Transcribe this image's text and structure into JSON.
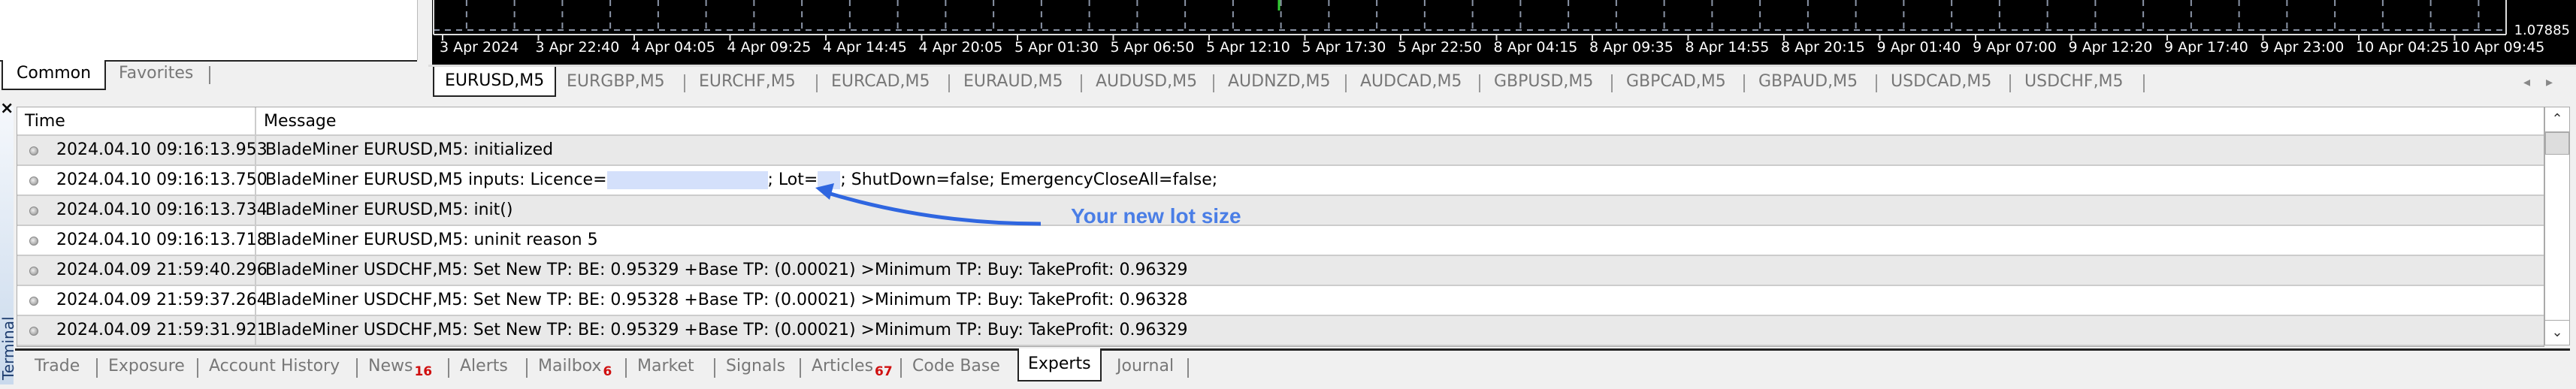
{
  "navigator": {
    "tabs": [
      {
        "label": "Common",
        "active": true
      },
      {
        "label": "Favorites",
        "active": false
      }
    ]
  },
  "chart": {
    "symbol": "EURUSD,M5",
    "price_label": "1.07885",
    "candle_color": "#33cc33",
    "time_labels": [
      "3 Apr 2024",
      "3 Apr 22:40",
      "4 Apr 04:05",
      "4 Apr 09:25",
      "4 Apr 14:45",
      "4 Apr 20:05",
      "5 Apr 01:30",
      "5 Apr 06:50",
      "5 Apr 12:10",
      "5 Apr 17:30",
      "5 Apr 22:50",
      "8 Apr 04:15",
      "8 Apr 09:35",
      "8 Apr 14:55",
      "8 Apr 20:15",
      "9 Apr 01:40",
      "9 Apr 07:00",
      "9 Apr 12:20",
      "9 Apr 17:40",
      "9 Apr 23:00",
      "10 Apr 04:25",
      "10 Apr 09:45"
    ]
  },
  "symbol_tabs": [
    {
      "label": "EURUSD,M5",
      "active": true
    },
    {
      "label": "EURGBP,M5",
      "active": false
    },
    {
      "label": "EURCHF,M5",
      "active": false
    },
    {
      "label": "EURCAD,M5",
      "active": false
    },
    {
      "label": "EURAUD,M5",
      "active": false
    },
    {
      "label": "AUDUSD,M5",
      "active": false
    },
    {
      "label": "AUDNZD,M5",
      "active": false
    },
    {
      "label": "AUDCAD,M5",
      "active": false
    },
    {
      "label": "GBPUSD,M5",
      "active": false
    },
    {
      "label": "GBPCAD,M5",
      "active": false
    },
    {
      "label": "GBPAUD,M5",
      "active": false
    },
    {
      "label": "USDCAD,M5",
      "active": false
    },
    {
      "label": "USDCHF,M5",
      "active": false
    }
  ],
  "symbol_tab_arrows": {
    "left": "◂",
    "right": "▸"
  },
  "terminal": {
    "title": "Terminal",
    "close": "×",
    "columns": {
      "time": "Time",
      "message": "Message"
    },
    "rows": [
      {
        "time": "2024.04.10 09:16:13.953",
        "message": "BladeMiner EURUSD,M5: initialized"
      },
      {
        "time": "2024.04.10 09:16:13.750",
        "message_prefix": "BladeMiner EURUSD,M5 inputs: Licence=",
        "message_mid": "; Lot=",
        "message_suffix": "; ShutDown=false; EmergencyCloseAll=false;",
        "redacted": true
      },
      {
        "time": "2024.04.10 09:16:13.734",
        "message": "BladeMiner EURUSD,M5: init()"
      },
      {
        "time": "2024.04.10 09:16:13.718",
        "message": "BladeMiner EURUSD,M5: uninit reason 5"
      },
      {
        "time": "2024.04.09 21:59:40.296",
        "message": "BladeMiner USDCHF,M5: Set New TP:  BE: 0.95329 +Base TP: (0.00021)  >Minimum TP: Buy: TakeProfit: 0.96329"
      },
      {
        "time": "2024.04.09 21:59:37.264",
        "message": "BladeMiner USDCHF,M5: Set New TP:  BE: 0.95328 +Base TP: (0.00021)  >Minimum TP: Buy: TakeProfit: 0.96328"
      },
      {
        "time": "2024.04.09 21:59:31.921",
        "message": "BladeMiner USDCHF,M5: Set New TP:  BE: 0.95329 +Base TP: (0.00021)  >Minimum TP: Buy: TakeProfit: 0.96329"
      }
    ],
    "tabs": [
      {
        "label": "Trade",
        "badge": ""
      },
      {
        "label": "Exposure",
        "badge": ""
      },
      {
        "label": "Account History",
        "badge": ""
      },
      {
        "label": "News",
        "badge": "16"
      },
      {
        "label": "Alerts",
        "badge": ""
      },
      {
        "label": "Mailbox",
        "badge": "6"
      },
      {
        "label": "Market",
        "badge": ""
      },
      {
        "label": "Signals",
        "badge": ""
      },
      {
        "label": "Articles",
        "badge": "67"
      },
      {
        "label": "Code Base",
        "badge": ""
      },
      {
        "label": "Experts",
        "badge": "",
        "active": true
      },
      {
        "label": "Journal",
        "badge": ""
      }
    ],
    "scroll": {
      "up": "⌃",
      "down": "⌄"
    }
  },
  "annotation": {
    "text": "Your new lot size",
    "color": "#4a7ee6"
  }
}
